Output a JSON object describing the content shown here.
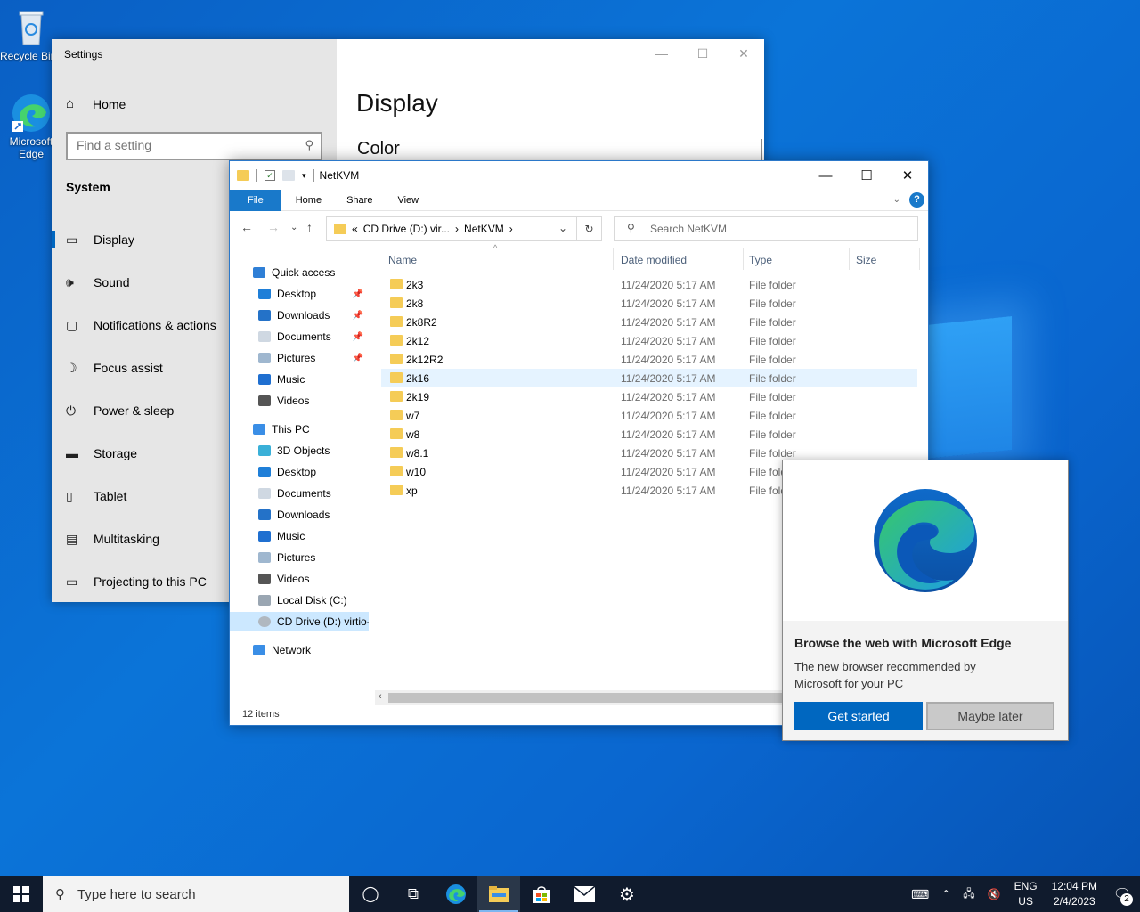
{
  "desktop": {
    "icons": [
      {
        "label": "Recycle Bin"
      },
      {
        "label": "Microsoft Edge"
      }
    ]
  },
  "settings": {
    "title": "Settings",
    "home_label": "Home",
    "search_placeholder": "Find a setting",
    "section": "System",
    "nav_items": [
      {
        "label": "Display",
        "icon": "monitor-icon",
        "selected": true
      },
      {
        "label": "Sound",
        "icon": "speaker-icon"
      },
      {
        "label": "Notifications & actions",
        "icon": "notification-icon"
      },
      {
        "label": "Focus assist",
        "icon": "moon-icon"
      },
      {
        "label": "Power & sleep",
        "icon": "power-icon"
      },
      {
        "label": "Storage",
        "icon": "storage-icon"
      },
      {
        "label": "Tablet",
        "icon": "tablet-icon"
      },
      {
        "label": "Multitasking",
        "icon": "multitasking-icon"
      },
      {
        "label": "Projecting to this PC",
        "icon": "projector-icon"
      }
    ],
    "page_title": "Display",
    "page_subtitle": "Color"
  },
  "explorer": {
    "title": "NetKVM",
    "ribbon_tabs": [
      "File",
      "Home",
      "Share",
      "View"
    ],
    "address": {
      "prefix": "«",
      "crumb1": "CD Drive (D:) vir...",
      "crumb2": "NetKVM"
    },
    "search_placeholder": "Search NetKVM",
    "nav_tree": [
      {
        "label": "Quick access",
        "icon": "star-icon",
        "indent": 1
      },
      {
        "label": "Desktop",
        "icon": "desktop-icon",
        "indent": 2,
        "pinned": true
      },
      {
        "label": "Downloads",
        "icon": "download-icon",
        "indent": 2,
        "pinned": true
      },
      {
        "label": "Documents",
        "icon": "documents-icon",
        "indent": 2,
        "pinned": true
      },
      {
        "label": "Pictures",
        "icon": "pictures-icon",
        "indent": 2,
        "pinned": true
      },
      {
        "label": "Music",
        "icon": "music-icon",
        "indent": 2
      },
      {
        "label": "Videos",
        "icon": "videos-icon",
        "indent": 2
      },
      {
        "label": "This PC",
        "icon": "computer-icon",
        "indent": 1
      },
      {
        "label": "3D Objects",
        "icon": "3d-objects-icon",
        "indent": 2
      },
      {
        "label": "Desktop",
        "icon": "desktop-icon",
        "indent": 2
      },
      {
        "label": "Documents",
        "icon": "documents-icon",
        "indent": 2
      },
      {
        "label": "Downloads",
        "icon": "download-icon",
        "indent": 2
      },
      {
        "label": "Music",
        "icon": "music-icon",
        "indent": 2
      },
      {
        "label": "Pictures",
        "icon": "pictures-icon",
        "indent": 2
      },
      {
        "label": "Videos",
        "icon": "videos-icon",
        "indent": 2
      },
      {
        "label": "Local Disk (C:)",
        "icon": "disk-icon",
        "indent": 2
      },
      {
        "label": "CD Drive (D:) virtio-",
        "icon": "cd-drive-icon",
        "indent": 2,
        "selected": true
      },
      {
        "label": "Network",
        "icon": "network-icon",
        "indent": 1
      }
    ],
    "columns": [
      "Name",
      "Date modified",
      "Type",
      "Size"
    ],
    "files": [
      {
        "name": "2k3",
        "date": "11/24/2020 5:17 AM",
        "type": "File folder"
      },
      {
        "name": "2k8",
        "date": "11/24/2020 5:17 AM",
        "type": "File folder"
      },
      {
        "name": "2k8R2",
        "date": "11/24/2020 5:17 AM",
        "type": "File folder"
      },
      {
        "name": "2k12",
        "date": "11/24/2020 5:17 AM",
        "type": "File folder"
      },
      {
        "name": "2k12R2",
        "date": "11/24/2020 5:17 AM",
        "type": "File folder"
      },
      {
        "name": "2k16",
        "date": "11/24/2020 5:17 AM",
        "type": "File folder",
        "hover": true
      },
      {
        "name": "2k19",
        "date": "11/24/2020 5:17 AM",
        "type": "File folder"
      },
      {
        "name": "w7",
        "date": "11/24/2020 5:17 AM",
        "type": "File folder"
      },
      {
        "name": "w8",
        "date": "11/24/2020 5:17 AM",
        "type": "File folder"
      },
      {
        "name": "w8.1",
        "date": "11/24/2020 5:17 AM",
        "type": "File folder"
      },
      {
        "name": "w10",
        "date": "11/24/2020 5:17 AM",
        "type": "File folder"
      },
      {
        "name": "xp",
        "date": "11/24/2020 5:17 AM",
        "type": "File folder"
      }
    ],
    "status": "12 items"
  },
  "edge_popup": {
    "heading": "Browse the web with Microsoft Edge",
    "body": "The new browser recommended by Microsoft for your PC",
    "primary_label": "Get started",
    "secondary_label": "Maybe later"
  },
  "taskbar": {
    "search_placeholder": "Type here to search",
    "lang_top": "ENG",
    "lang_bottom": "US",
    "time": "12:04 PM",
    "date": "2/4/2023",
    "notification_count": "2"
  }
}
